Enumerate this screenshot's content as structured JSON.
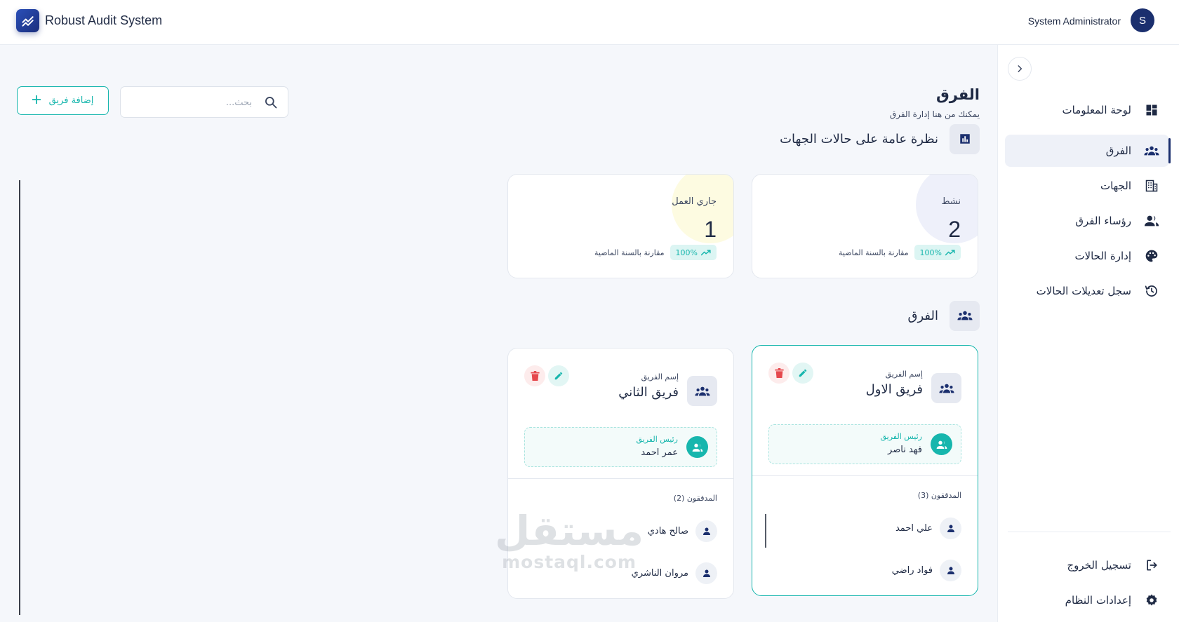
{
  "app": {
    "title": "Robust Audit System"
  },
  "user": {
    "name": "System Administrator",
    "initial": "S"
  },
  "sidebar": {
    "items": [
      {
        "label": "لوحة المعلومات",
        "icon": "dashboard-icon"
      },
      {
        "label": "الفرق",
        "icon": "groups-icon",
        "active": true
      },
      {
        "label": "الجهات",
        "icon": "building-icon"
      },
      {
        "label": "رؤساء الفرق",
        "icon": "people-icon"
      },
      {
        "label": "إدارة الحالات",
        "icon": "palette-icon"
      },
      {
        "label": "سجل تعديلات الحالات",
        "icon": "history-icon"
      }
    ],
    "bottom": [
      {
        "label": "تسجيل الخروج",
        "icon": "logout-icon"
      },
      {
        "label": "إعدادات النظام",
        "icon": "settings-icon"
      }
    ]
  },
  "main": {
    "title": "الفرق",
    "subtitle": "يمكنك من هنا إدارة الفرق",
    "add_button": "إضافة فريق",
    "search": {
      "placeholder": "بحث...",
      "value": ""
    },
    "overview_title": "نظرة عامة على حالات الجهات",
    "teams_title": "الفرق"
  },
  "stats": [
    {
      "label": "نشط",
      "value": "2",
      "trend": "100%",
      "compare": "مقارنة بالسنة الماضية",
      "blob_color": "#eef0fa"
    },
    {
      "label": "جاري العمل",
      "value": "1",
      "trend": "100%",
      "compare": "مقارنة بالسنة الماضية",
      "blob_color": "#fdfbe1"
    }
  ],
  "teams": [
    {
      "name_label": "إسم الفريق",
      "name": "فريق الاول",
      "leader_label": "رئيس الفريق",
      "leader": "فهد ناصر",
      "auditors_label": "المدققون (3)",
      "auditors": [
        "علي احمد",
        "فواد راضي"
      ]
    },
    {
      "name_label": "إسم الفريق",
      "name": "فريق الثاني",
      "leader_label": "رئيس الفريق",
      "leader": "عمر احمد",
      "auditors_label": "المدققون (2)",
      "auditors": [
        "صالح هادي",
        "مروان الناشري"
      ]
    }
  ],
  "watermark": {
    "arabic": "مستقل",
    "latin": "mostaql.com"
  },
  "colors": {
    "primary": "#1b2f6e",
    "accent": "#17b6ad",
    "danger": "#e5484d"
  }
}
